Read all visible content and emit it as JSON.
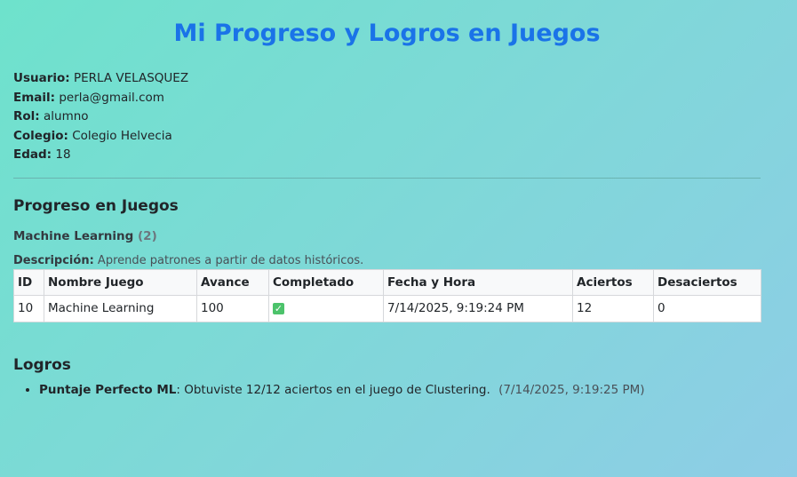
{
  "page_title": "Mi Progreso y Logros en Juegos",
  "user_info": [
    {
      "label": "Usuario:",
      "value": "PERLA VELASQUEZ"
    },
    {
      "label": "Email:",
      "value": "perla@gmail.com"
    },
    {
      "label": "Rol:",
      "value": "alumno"
    },
    {
      "label": "Colegio:",
      "value": "Colegio Helvecia"
    },
    {
      "label": "Edad:",
      "value": "18"
    }
  ],
  "progress": {
    "title": "Progreso en Juegos",
    "game_name": "Machine Learning",
    "game_count": "(2)",
    "desc_label": "Descripción:",
    "desc_text": "Aprende patrones a partir de datos históricos.",
    "columns": [
      "ID",
      "Nombre Juego",
      "Avance",
      "Completado",
      "Fecha y Hora",
      "Aciertos",
      "Desaciertos"
    ],
    "rows": [
      {
        "id": "10",
        "name": "Machine Learning",
        "avance": "100",
        "completado": "✓",
        "fecha": "7/14/2025, 9:19:24 PM",
        "aciertos": "12",
        "desaciertos": "0"
      }
    ]
  },
  "achievements": {
    "title": "Logros",
    "items": [
      {
        "name": "Puntaje Perfecto ML",
        "text": ": Obtuviste 12/12 aciertos en el juego de Clustering.",
        "date": "(7/14/2025, 9:19:25 PM)"
      }
    ]
  },
  "colors": {
    "title": "#1a73e8",
    "check": "#4cc36b",
    "background_start": "#6ee2cc",
    "background_end": "#8ecde6"
  }
}
